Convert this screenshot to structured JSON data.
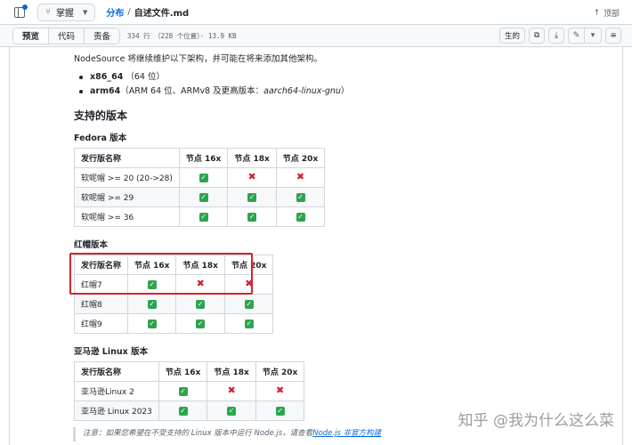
{
  "topbar": {
    "branch": "掌握",
    "repo": "分布",
    "separator": "/",
    "file": "自述文件.md",
    "top_link": "顶部",
    "top_icon": "arrow-up-icon"
  },
  "toolbar": {
    "tabs": [
      "预览",
      "代码",
      "责备"
    ],
    "meta": "334 行 （228 个位置）· 13.9 KB",
    "raw_label": "生的",
    "icons": [
      "copy-icon",
      "download-icon",
      "edit-icon",
      "chevron-down-icon",
      "list-icon"
    ]
  },
  "readme": {
    "intro": "NodeSource 将继续维护以下架构，并可能在将来添加其他架构。",
    "archs": [
      {
        "name": "x86_64",
        "desc": "（64 位）"
      },
      {
        "name": "arm64",
        "desc": "（ARM 64 位、ARMv8 及更高版本：",
        "code": "aarch64-linux-gnu",
        "tail": "）"
      }
    ],
    "supported_heading": "支持的版本",
    "fedora_heading": "Fedora 版本",
    "redhat_heading": "红帽版本",
    "amazon_heading": "亚马逊 Linux 版本",
    "headers": [
      "发行版名称",
      "节点 16x",
      "节点 18x",
      "节点 20x"
    ],
    "fedora_rows": [
      {
        "name": "软呢帽 >= 20 (20->28)",
        "v": [
          "yes",
          "no",
          "no"
        ]
      },
      {
        "name": "软呢帽 >= 29",
        "v": [
          "yes",
          "yes",
          "yes"
        ]
      },
      {
        "name": "软呢帽 >= 36",
        "v": [
          "yes",
          "yes",
          "yes"
        ]
      }
    ],
    "redhat_rows": [
      {
        "name": "红帽7",
        "v": [
          "yes",
          "no",
          "no"
        ]
      },
      {
        "name": "红帽8",
        "v": [
          "yes",
          "yes",
          "yes"
        ]
      },
      {
        "name": "红帽9",
        "v": [
          "yes",
          "yes",
          "yes"
        ]
      }
    ],
    "amazon_rows": [
      {
        "name": "亚马逊Linux 2",
        "v": [
          "yes",
          "no",
          "no"
        ]
      },
      {
        "name": "亚马逊 Linux 2023",
        "v": [
          "yes",
          "yes",
          "yes"
        ]
      }
    ],
    "note_text": "注意：如果您希望在不受支持的 Linux 版本中运行 Node.js，请查看",
    "note_link": "Node.js 非官方构建"
  },
  "watermark": "知乎 @我为什么这么菜",
  "colors": {
    "accent": "#0969da",
    "ok": "#2da44e",
    "no": "#cf222e",
    "highlight": "#d1242f"
  }
}
